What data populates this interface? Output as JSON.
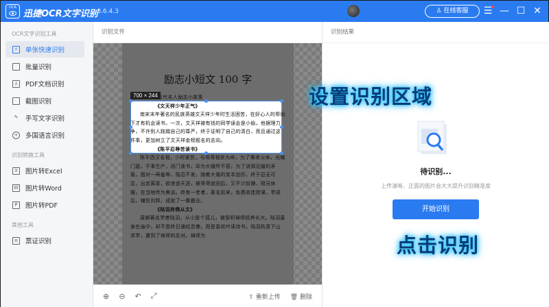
{
  "app": {
    "logo_text": "OCR",
    "name": "迅捷OCR文字识别",
    "version": "v8.6.4.3",
    "service_label": "在线客服"
  },
  "sidebar": {
    "section_ocr": "OCR文字识别工具",
    "section_convert": "识别转换工具",
    "section_other": "其他工具",
    "items": [
      {
        "label": "单张快速识别",
        "icon": "single-scan-icon"
      },
      {
        "label": "批量识别",
        "icon": "batch-icon"
      },
      {
        "label": "PDF文档识别",
        "icon": "pdf-icon"
      },
      {
        "label": "截图识别",
        "icon": "crop-icon"
      },
      {
        "label": "手写文字识别",
        "icon": "pen-icon"
      },
      {
        "label": "多国语言识别",
        "icon": "globe-icon"
      },
      {
        "label": "图片转Excel",
        "icon": "excel-icon",
        "glyph": "X"
      },
      {
        "label": "图片转Word",
        "icon": "word-icon",
        "glyph": "W"
      },
      {
        "label": "图片转PDF",
        "icon": "pdf-file-icon",
        "glyph": "P"
      },
      {
        "label": "票证识别",
        "icon": "ticket-icon"
      }
    ]
  },
  "left_pane": {
    "title": "识别文件",
    "selection_size": "700 × 244",
    "reupload": "重新上传",
    "delete": "删除"
  },
  "document": {
    "title": "励志小短文 100 字",
    "subtitle": "古代名人励志小故事",
    "h1": "《文天祥少年正气》",
    "p1": "南宋末年著名的民族英雄文天祥少年时生活困苦，在好心人的帮助下才有机会读书。一次，文天祥被有钱的同学误会是小偷，他据理力争，不许别人践踏自己的尊严，终于证明了自己的清白，而且通过这件事，更加树立了文天祥金榜题名的志向。",
    "h2": "《陈平忍辱苦读书》",
    "p2": "陈平西汉名相，少时家贫，与哥哥相依为命，为了秉承父命，光耀门庭，不事生产，闭门读书，却为大嫂所不容，为了消弭兄嫂的矛盾，面对一再羞辱，隐忍不发，随着大嫂的变本加厉，终于忍无可忍，出走离家，欲浪迹天涯，被哥哥追回后，又不计前嫌，阻兄休嫂，在当地传为美谈。终有一老者，慕名前来，免费收徒授课，学成后，辅佐刘邦，成就了一番霸业。",
    "h3": "《陆羽弃佛从文》",
    "p3": "唐朝著名学者陆羽，从小是个孤儿，被智积禅师抚养长大。陆羽虽身在庙中，却不愿终日诵经念佛，而是喜欢吟读诗书。陆羽执意下山求学，遭到了禅师的反对。禅师为"
  },
  "right_pane": {
    "title": "识别结果",
    "status": "待识别...",
    "hint": "上传清晰、正面的图片会大大提升识别精准度",
    "start_button": "开始识别"
  },
  "annotations": {
    "set_area": "设置识别区域",
    "click_recognize": "点击识别"
  },
  "colors": {
    "accent": "#2b7bf0"
  }
}
